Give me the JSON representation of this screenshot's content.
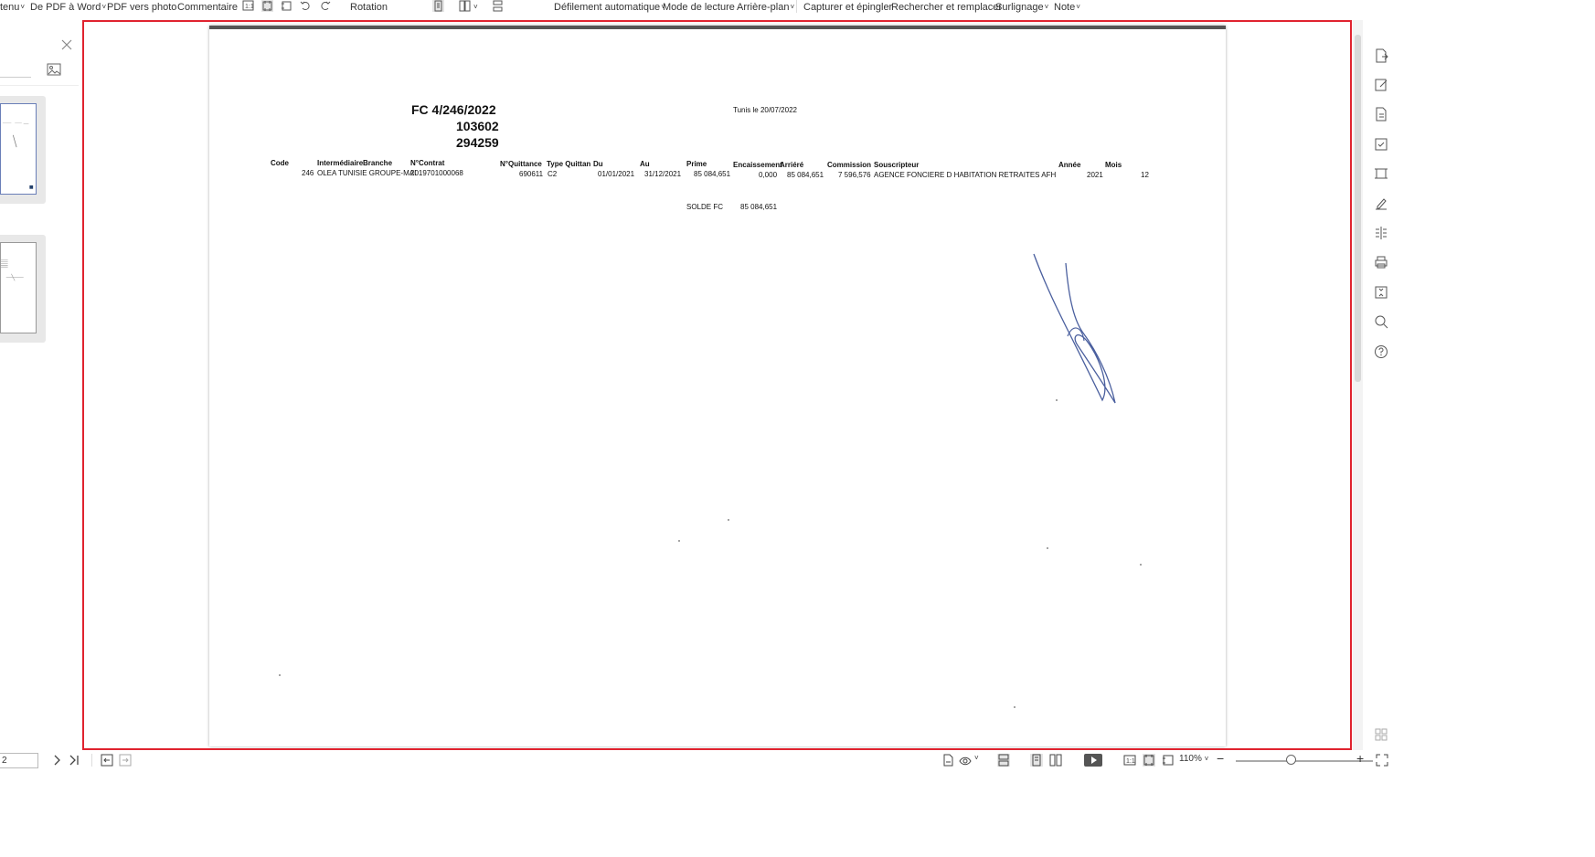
{
  "toolbar": {
    "menu_label": "tenu",
    "pdf_to_word": "De PDF à Word",
    "pdf_to_photo": "PDF vers photo",
    "comment": "Commentaire",
    "rotation": "Rotation",
    "auto_scroll": "Défilement automatique",
    "reading_mode": "Mode de lecture",
    "background": "Arrière-plan",
    "capture_pin": "Capturer et épingler",
    "find_replace": "Rechercher et remplacer",
    "highlight": "Surlignage",
    "note": "Note",
    "caret": "˅"
  },
  "document": {
    "fc_ref": "FC 4/246/2022",
    "ref_num_1": "103602",
    "ref_num_2": "294259",
    "date_line": "Tunis le 20/07/2022",
    "headers": {
      "code": "Code",
      "intermediaire": "Intermédiaire",
      "branche": "Branche",
      "contrat": "N°Contrat",
      "quittance": "N°Quittance",
      "type_quittance": "Type Quittan",
      "du": "Du",
      "au": "Au",
      "prime": "Prime",
      "encaissement": "Encaissement",
      "arriere": "Arriéré",
      "commission": "Commission",
      "souscripteur": "Souscripteur",
      "annee": "Année",
      "mois": "Mois"
    },
    "row": {
      "code": "246",
      "intermediaire": "OLEA TUNISIE GROUPE-MAI",
      "contrat": "2019701000068",
      "quittance": "690611",
      "type": "C2",
      "du": "01/01/2021",
      "au": "31/12/2021",
      "prime": "85 084,651",
      "encaissement": "0,000",
      "arriere": "85 084,651",
      "commission": "7 596,576",
      "souscripteur": "AGENCE FONCIERE D  HABITATION RETRAITES AFH",
      "annee": "2021",
      "mois": "12"
    },
    "solde_label": "SOLDE FC",
    "solde_value": "85 084,651"
  },
  "statusbar": {
    "page_value": "2",
    "zoom": "110%",
    "zoom_caret": "˅",
    "minus": "−",
    "plus": "+"
  },
  "colors": {
    "selection_border": "#e0232f",
    "signature_ink": "#4a5f9e"
  }
}
